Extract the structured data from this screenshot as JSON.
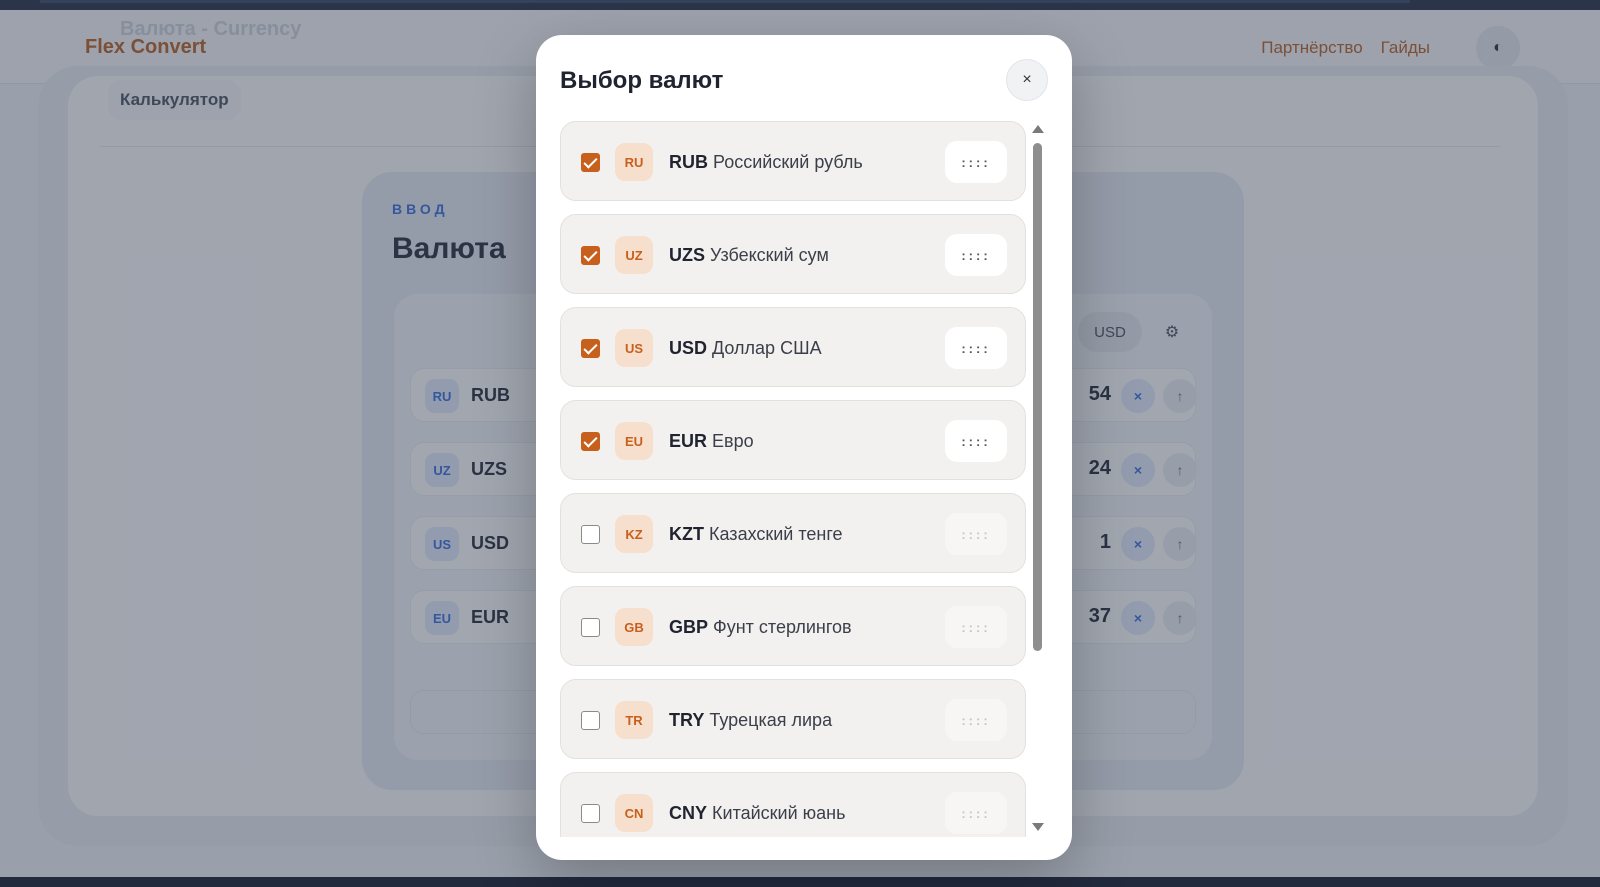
{
  "app": {
    "ghost_title": "Валюта - Currency",
    "logo": "Flex Convert",
    "nav": [
      "Партнёрство",
      "Гайды"
    ],
    "theme_icon": "◐"
  },
  "background": {
    "tab": "Калькулятор",
    "section_label": "ВВОД",
    "section_title": "Валюта",
    "base_currency": "USD",
    "rows": [
      {
        "badge": "RU",
        "code": "RUB",
        "value": "54"
      },
      {
        "badge": "UZ",
        "code": "UZS",
        "value": "24"
      },
      {
        "badge": "US",
        "code": "USD",
        "value": "1"
      },
      {
        "badge": "EU",
        "code": "EUR",
        "value": "37"
      }
    ],
    "remove_label": "×",
    "up_label": "↑",
    "gear_label": "⚙"
  },
  "modal": {
    "title": "Выбор валют",
    "close_label": "×",
    "handle_label": "::::",
    "items": [
      {
        "flag": "RU",
        "code": "RUB",
        "name": "Российский рубль",
        "checked": true
      },
      {
        "flag": "UZ",
        "code": "UZS",
        "name": "Узбекский сум",
        "checked": true
      },
      {
        "flag": "US",
        "code": "USD",
        "name": "Доллар США",
        "checked": true
      },
      {
        "flag": "EU",
        "code": "EUR",
        "name": "Евро",
        "checked": true
      },
      {
        "flag": "KZ",
        "code": "KZT",
        "name": "Казахский тенге",
        "checked": false
      },
      {
        "flag": "GB",
        "code": "GBP",
        "name": "Фунт стерлингов",
        "checked": false
      },
      {
        "flag": "TR",
        "code": "TRY",
        "name": "Турецкая лира",
        "checked": false
      },
      {
        "flag": "CN",
        "code": "CNY",
        "name": "Китайский юань",
        "checked": false
      }
    ]
  },
  "colors": {
    "accent": "#c8601d",
    "link": "#b4632a",
    "blue": "#3b6ed8"
  }
}
